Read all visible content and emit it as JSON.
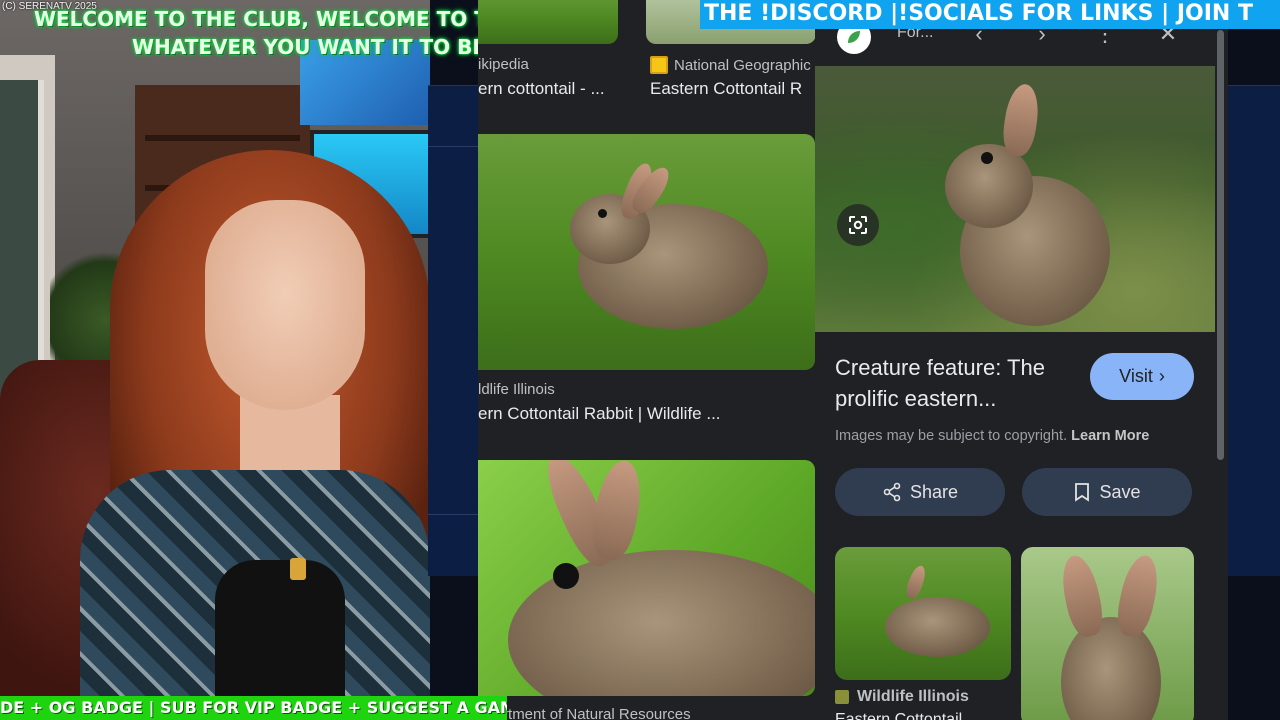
{
  "overlay": {
    "copyright": "(C) SERENATV 2025",
    "welcome_line1": "WELCOME TO THE CLUB, WELCOME TO THE CULT,",
    "welcome_line2": "WHATEVER YOU WANT IT TO BE",
    "top_ticker": "THE !DISCORD |!SOCIALS FOR LINKS | JOIN T",
    "bottom_ticker": "DE + OG BADGE | SUB FOR VIP BADGE + SUGGEST A GAME"
  },
  "results": [
    {
      "source": "ikipedia",
      "title": "ern cottontail - ..."
    },
    {
      "source": "National Geographic",
      "title": "Eastern Cottontail R"
    },
    {
      "source": "ldlife Illinois",
      "title": "ern Cottontail Rabbit | Wildlife ..."
    },
    {
      "source": "epartment of Natural Resources",
      "title": ""
    }
  ],
  "panel": {
    "site_name": "For...",
    "title": "Creature feature: The prolific eastern...",
    "visit_label": "Visit",
    "copyright_note": "Images may be subject to copyright.",
    "learn_more": "Learn More",
    "share_label": "Share",
    "save_label": "Save",
    "related_source": "Wildlife Illinois",
    "related_title": "Eastern Cottontail ..."
  },
  "colors": {
    "accent_blue": "#8ab4f8",
    "panel_bg": "#202124",
    "ticker_top": "#0fa3f0",
    "ticker_bottom": "#1ed40f"
  },
  "icons": {
    "lens": "google-lens-icon",
    "back": "chevron-left-icon",
    "forward": "chevron-right-icon",
    "more": "more-vert-icon",
    "close": "close-icon",
    "share": "share-icon",
    "save": "bookmark-icon"
  }
}
